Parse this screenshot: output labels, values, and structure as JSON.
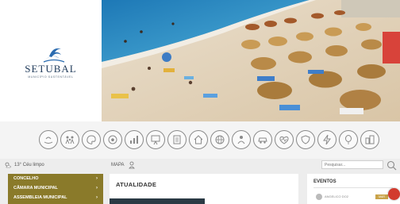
{
  "brand": {
    "name": "SETUBAL",
    "tagline": "MUNICÍPIO SUSTENTÁVEL",
    "logo_icon": "dolphin-wave-icon"
  },
  "hero": {
    "image": "beach-with-parasols-aerial-photo"
  },
  "category_icons": [
    "recycling-hand-icon",
    "family-icon",
    "palette-icon",
    "football-icon",
    "statistics-icon",
    "presentation-icon",
    "document-icon",
    "house-icon",
    "globe-icon",
    "team-icon",
    "vehicle-icon",
    "heart-pulse-icon",
    "shield-icon",
    "lightning-icon",
    "balloon-icon",
    "buildings-icon"
  ],
  "info_bar": {
    "weather_icon": "partly-cloudy-icon",
    "weather_text": "13° Céu limpo",
    "map_label": "MAPA",
    "map_icon": "map-pin-person-icon",
    "search_placeholder": "Pesquisar...",
    "search_icon": "search-icon"
  },
  "menu": {
    "items": [
      {
        "label": "CONCELHO",
        "arrow": "›"
      },
      {
        "label": "CÂMARA MUNICIPAL",
        "arrow": "›"
      },
      {
        "label": "ASSEMBLEIA MUNICIPAL",
        "arrow": "›"
      }
    ]
  },
  "news": {
    "title": "ATUALIDADE"
  },
  "events": {
    "title": "EVENTOS",
    "item_name": "ANGELICO DO2",
    "item_badge": "MAR",
    "chat_icon": "chat-bubble-icon"
  },
  "colors": {
    "menu_bg": "#8a7a2a",
    "accent_red": "#d23b2e",
    "brand_blue": "#1f3a5a"
  }
}
